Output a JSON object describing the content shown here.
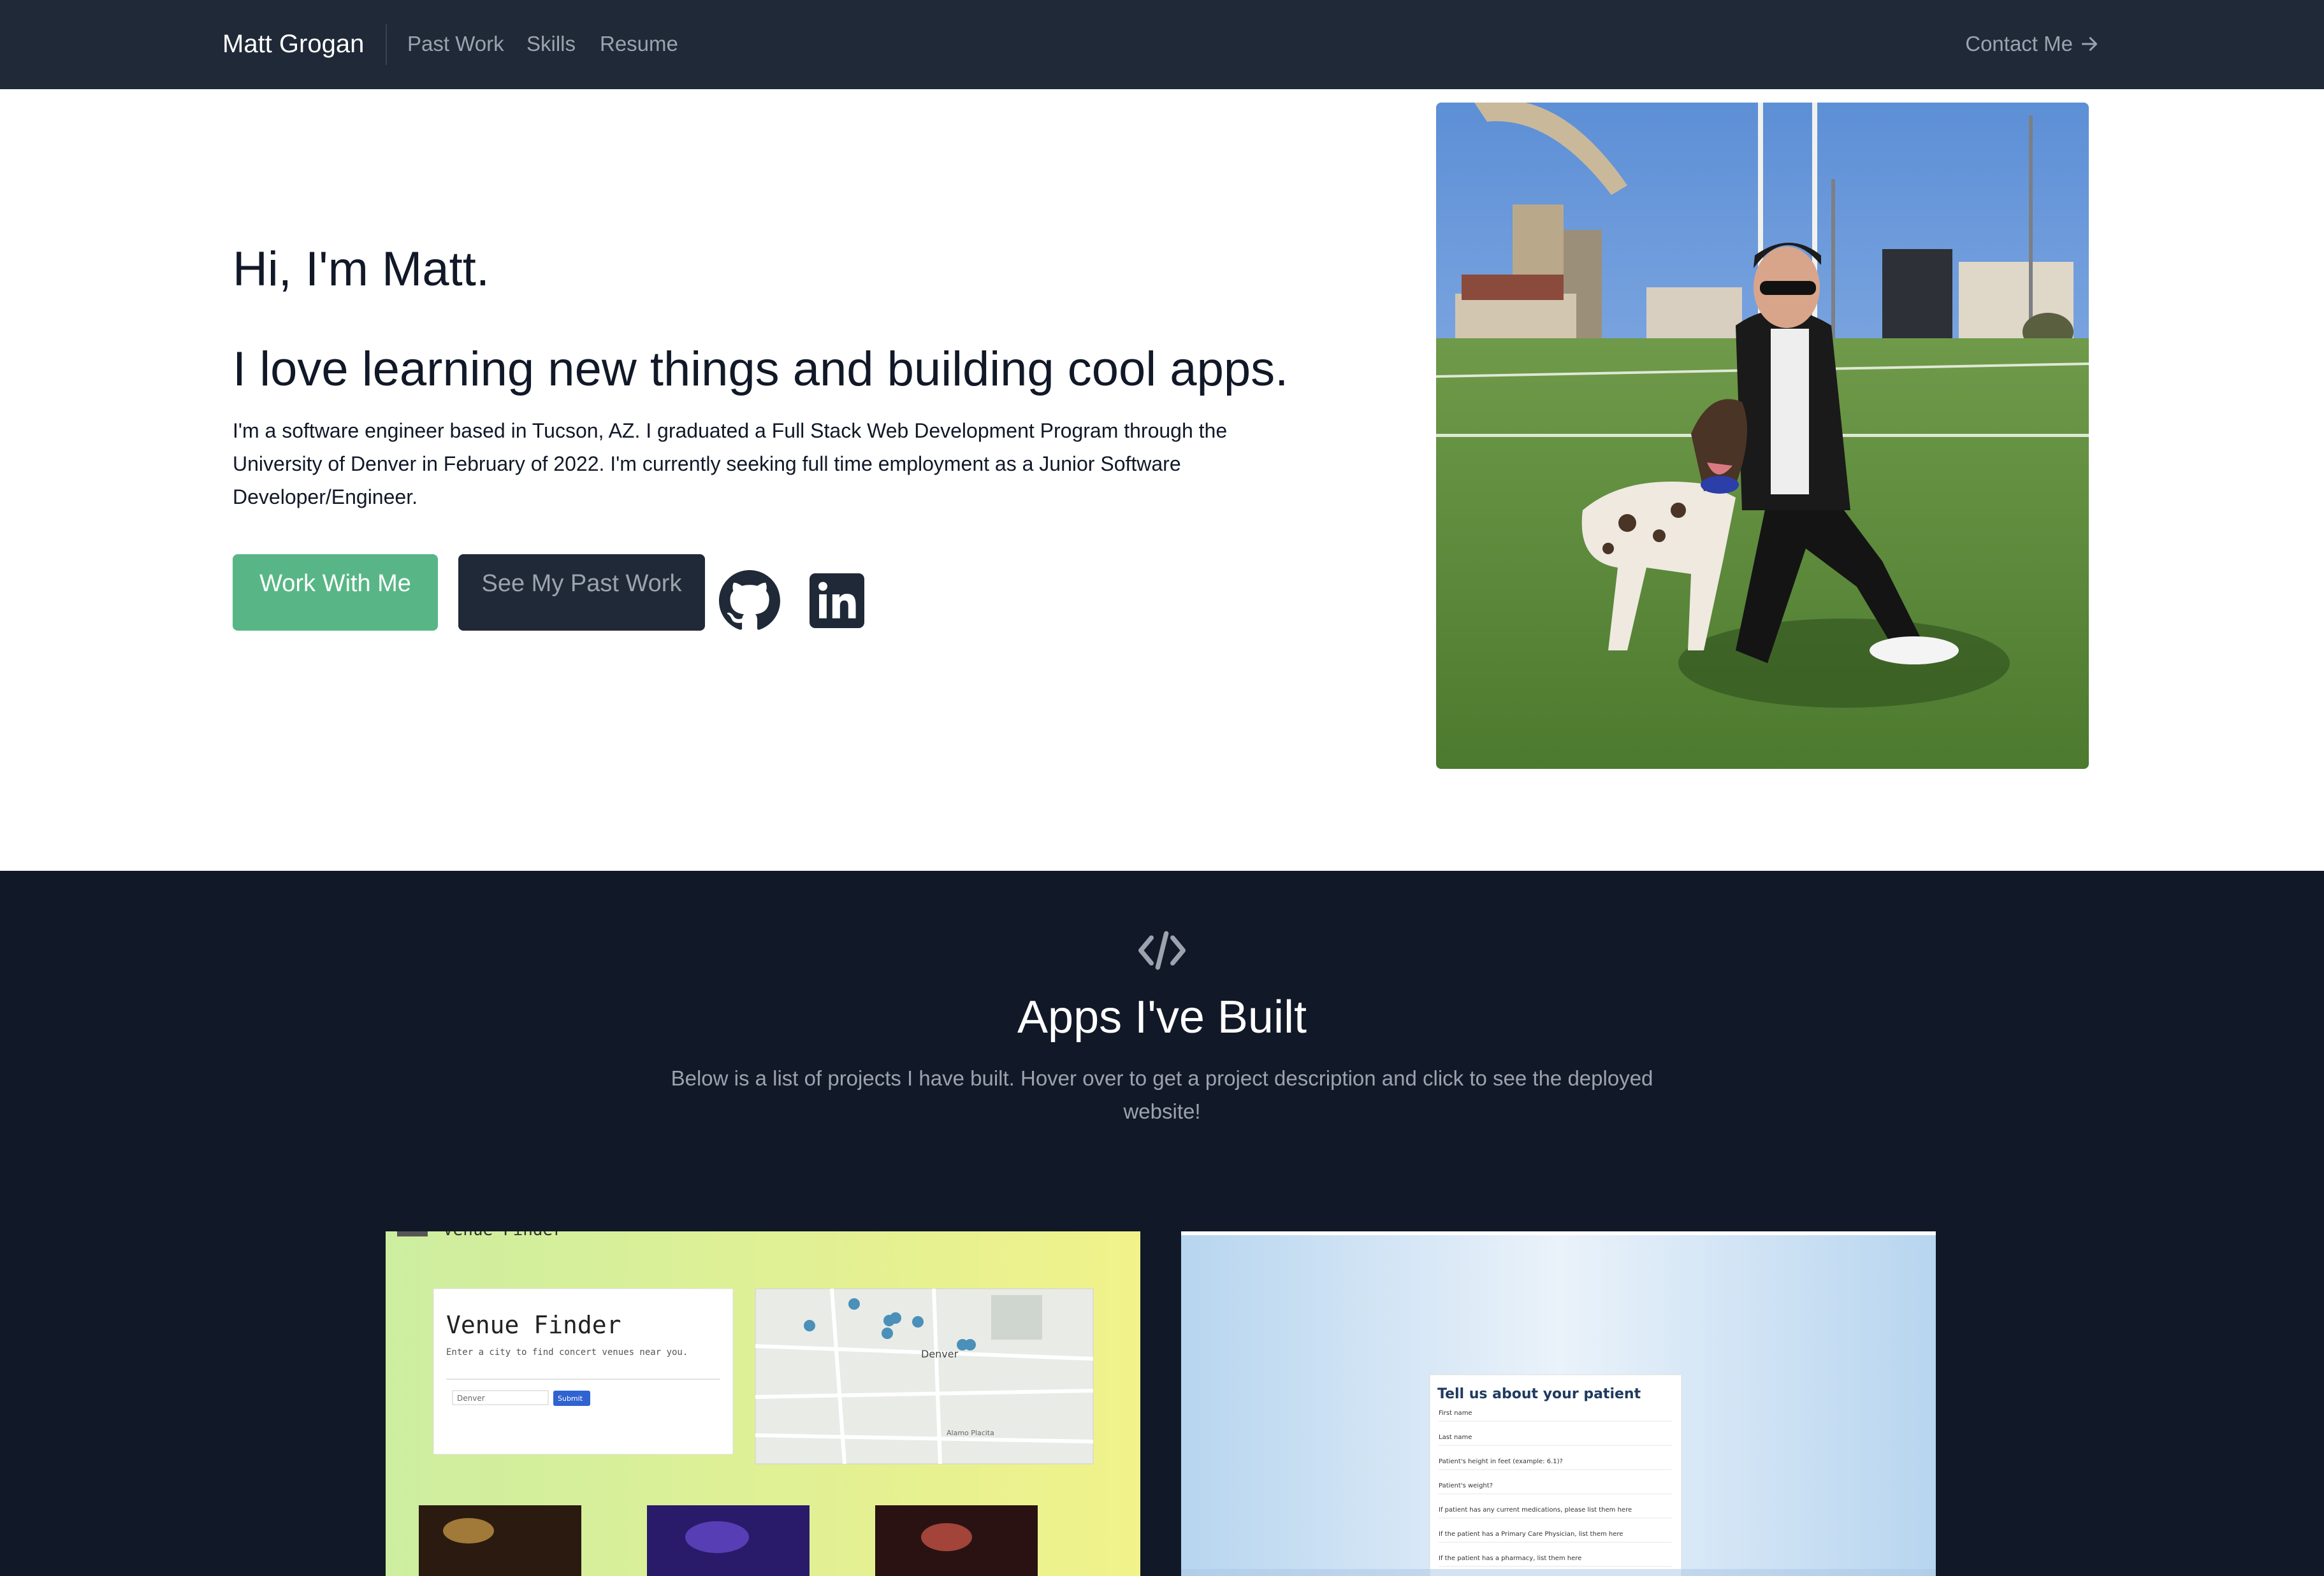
{
  "nav": {
    "brand": "Matt Grogan",
    "links": [
      "Past Work",
      "Skills",
      "Resume"
    ],
    "contact": "Contact Me"
  },
  "hero": {
    "greeting": "Hi, I'm Matt.",
    "headline": "I love learning new things and building cool apps.",
    "bio": "I'm a software engineer based in Tucson, AZ. I graduated a Full Stack Web Development Program through the University of Denver in February of 2022. I'm currently seeking full time employment as a Junior Software Developer/Engineer.",
    "primary_button": "Work With Me",
    "secondary_button": "See My Past Work",
    "social_icons": [
      "github-icon",
      "linkedin-icon"
    ]
  },
  "projects": {
    "title": "Apps I've Built",
    "description": "Below is a list of projects I have built. Hover over to get a project description and click to see the deployed website!",
    "cards": [
      {
        "app_title": "Venue Finder",
        "header_text": "Venue Finder",
        "subtitle": "Enter a city to find concert venues near you.",
        "input_value": "Denver",
        "submit_label": "Submit",
        "map_city": "Denver",
        "map_label": "Alamo Placita"
      },
      {
        "form_title": "Tell us about your patient",
        "fields": [
          "First name",
          "Last name",
          "Patient's height in feet (example: 6.1)?",
          "Patient's weight?",
          "If patient has any current medications, please list them here",
          "If the patient has a Primary Care Physician, list them here",
          "If the patient has a pharmacy, list them here"
        ]
      }
    ]
  },
  "colors": {
    "nav_bg": "#1f2937",
    "section_bg": "#111827",
    "accent_green": "#58b686",
    "muted_text": "#9ca3af"
  }
}
